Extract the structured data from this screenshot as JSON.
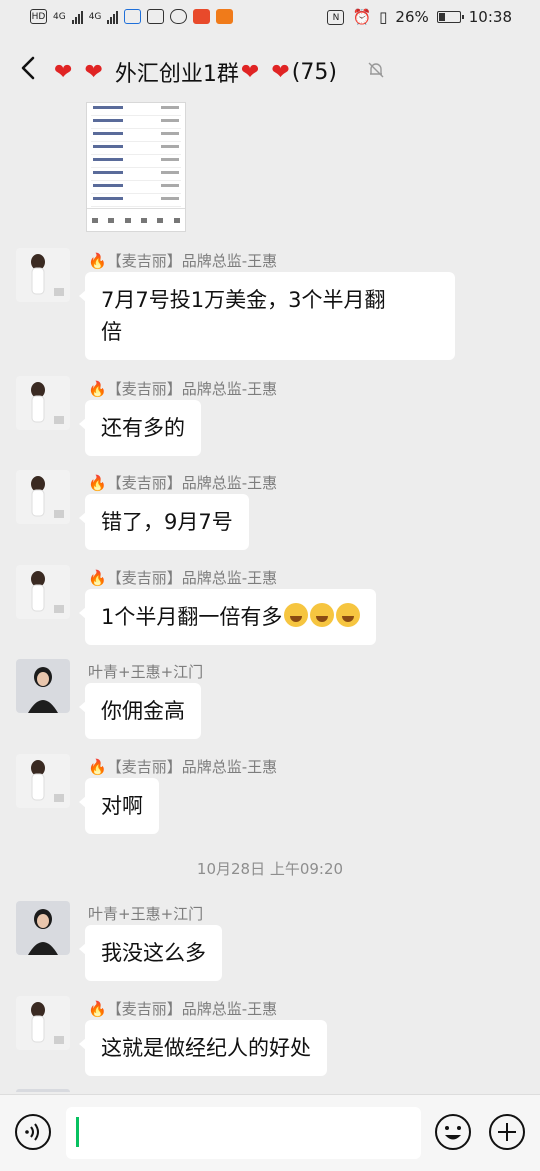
{
  "status_bar": {
    "hd_label": "HD",
    "net1": "4G",
    "net2": "4G",
    "nfc": "N",
    "battery_text": "26%",
    "battery_level": 0.26,
    "time": "10:38"
  },
  "header": {
    "title": "外汇创业1群",
    "heart": "❤",
    "member_count": "(75)"
  },
  "messages": [
    {
      "sender": "【麦吉丽】品牌总监-王惠",
      "text1": "7月7号投1万美金，3个半月翻",
      "text2": "倍"
    },
    {
      "sender": "【麦吉丽】品牌总监-王惠",
      "text": "还有多的"
    },
    {
      "sender": "【麦吉丽】品牌总监-王惠",
      "text": "错了，9月7号"
    },
    {
      "sender": "【麦吉丽】品牌总监-王惠",
      "text": "1个半月翻一倍有多"
    },
    {
      "sender": "叶青+王惠+江门",
      "text": "你佣金高"
    },
    {
      "sender": "【麦吉丽】品牌总监-王惠",
      "text": "对啊"
    },
    {
      "sender": "叶青+王惠+江门",
      "text": "我没这么多"
    },
    {
      "sender": "【麦吉丽】品牌总监-王惠",
      "text": "这就是做经纪人的好处"
    }
  ],
  "time_divider": "10月28日 上午09:20",
  "fire_glyph": "🔥",
  "icons": {
    "back": "back-arrow-icon",
    "mute": "mute-bell-icon",
    "voice": "voice-icon",
    "emoji": "emoji-icon",
    "plus": "plus-icon",
    "laugh": "laughing-crying-emoji"
  },
  "colors": {
    "heart": "#e02424",
    "caret": "#07c160",
    "background": "#ededed"
  }
}
